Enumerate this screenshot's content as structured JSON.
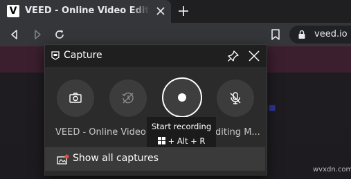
{
  "browser": {
    "tab_title": "VEED - Online Video Editor - Video Editing Made Simple",
    "favicon_letter": "V",
    "url": "veed.io",
    "icons": [
      "close-icon",
      "plus-icon",
      "back-icon",
      "forward-icon",
      "reload-icon",
      "bookmark-icon",
      "lock-icon"
    ]
  },
  "capture": {
    "title": "Capture",
    "buttons": [
      {
        "name": "screenshot",
        "icon": "camera-icon"
      },
      {
        "name": "record-last-30s",
        "icon": "history-record-icon"
      },
      {
        "name": "start-recording",
        "icon": "record-dot-icon"
      },
      {
        "name": "mic",
        "icon": "mic-off-icon"
      }
    ],
    "source_text_left": "VEED - Online Video Editor - Video Editing Made Simple",
    "source_text_right": "diting M...",
    "tooltip": {
      "title": "Start recording",
      "shortcut": "+ Alt + R"
    },
    "show_all_label": "Show all captures"
  },
  "watermark": "wvxdn.com",
  "colors": {
    "accent_record_ring": "#ffffff",
    "panel": "#2b2b2b",
    "header": "#1f1f1f"
  }
}
